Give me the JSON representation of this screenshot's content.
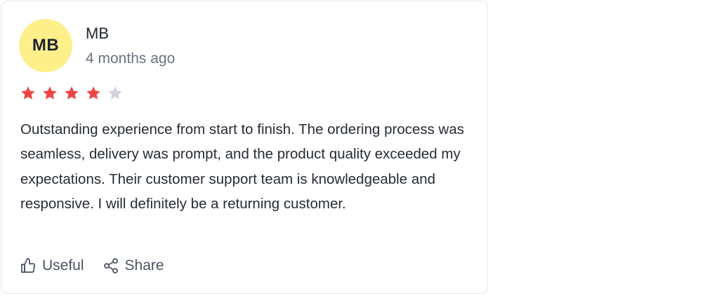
{
  "review": {
    "avatar_initials": "MB",
    "author": "MB",
    "time_ago": "4 months ago",
    "rating": 4,
    "rating_max": 5,
    "text": "Outstanding experience from start to finish. The ordering process was seamless, delivery was prompt, and the product quality exceeded my expectations. Their customer support team is knowledgeable and responsive. I will definitely be a returning customer."
  },
  "actions": {
    "useful_label": "Useful",
    "useful_icon": "thumbs-up-icon",
    "share_label": "Share",
    "share_icon": "share-icon"
  },
  "colors": {
    "avatar_bg": "#fdf08a",
    "star_filled": "#ef4444",
    "star_empty": "#d1d5db",
    "text_primary": "#1f2430",
    "text_muted": "#6b7280"
  }
}
